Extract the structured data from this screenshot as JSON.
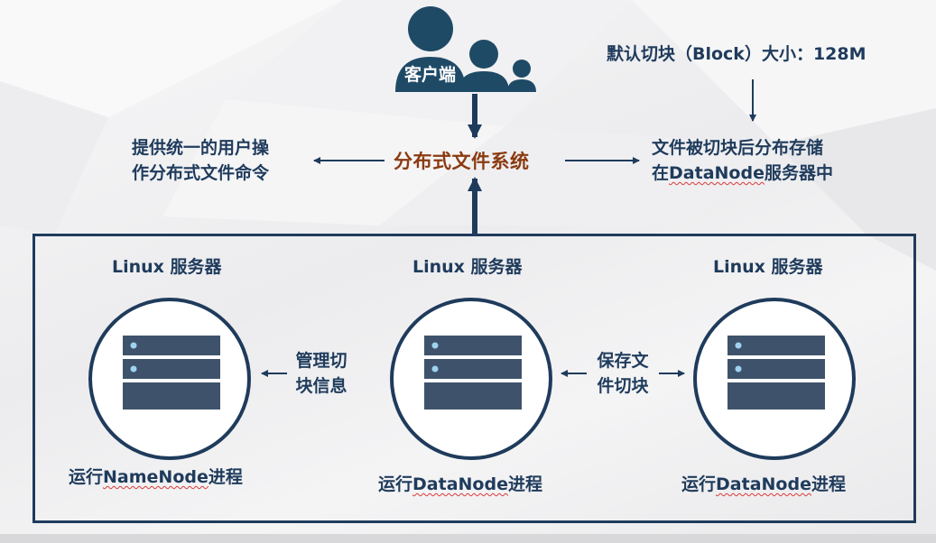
{
  "client": {
    "label": "客户端"
  },
  "block_note": "默认切块（Block）大小：128M",
  "center": {
    "title": "分布式文件系统"
  },
  "left_note": {
    "line1": "提供统一的用户操",
    "line2": "作分布式文件命令"
  },
  "right_note": {
    "line1": "文件被切块后分布存储",
    "line2_prefix": "在",
    "line2_term": "DataNode",
    "line2_suffix": "服务器中"
  },
  "servers": [
    {
      "label": "Linux 服务器",
      "proc_prefix": "运行",
      "proc_term": "NameNode",
      "proc_suffix": "进程"
    },
    {
      "label": "Linux 服务器",
      "proc_prefix": "运行",
      "proc_term": "DataNode",
      "proc_suffix": "进程"
    },
    {
      "label": "Linux 服务器",
      "proc_prefix": "运行",
      "proc_term": "DataNode",
      "proc_suffix": "进程"
    }
  ],
  "link_notes": [
    {
      "line1": "管理切",
      "line2": "块信息"
    },
    {
      "line1": "保存文",
      "line2": "件切块"
    }
  ],
  "colors": {
    "navy": "#1f3b5c",
    "accent": "#8b3a10",
    "server_body": "#3e536b",
    "server_light": "#9fd2f0"
  }
}
